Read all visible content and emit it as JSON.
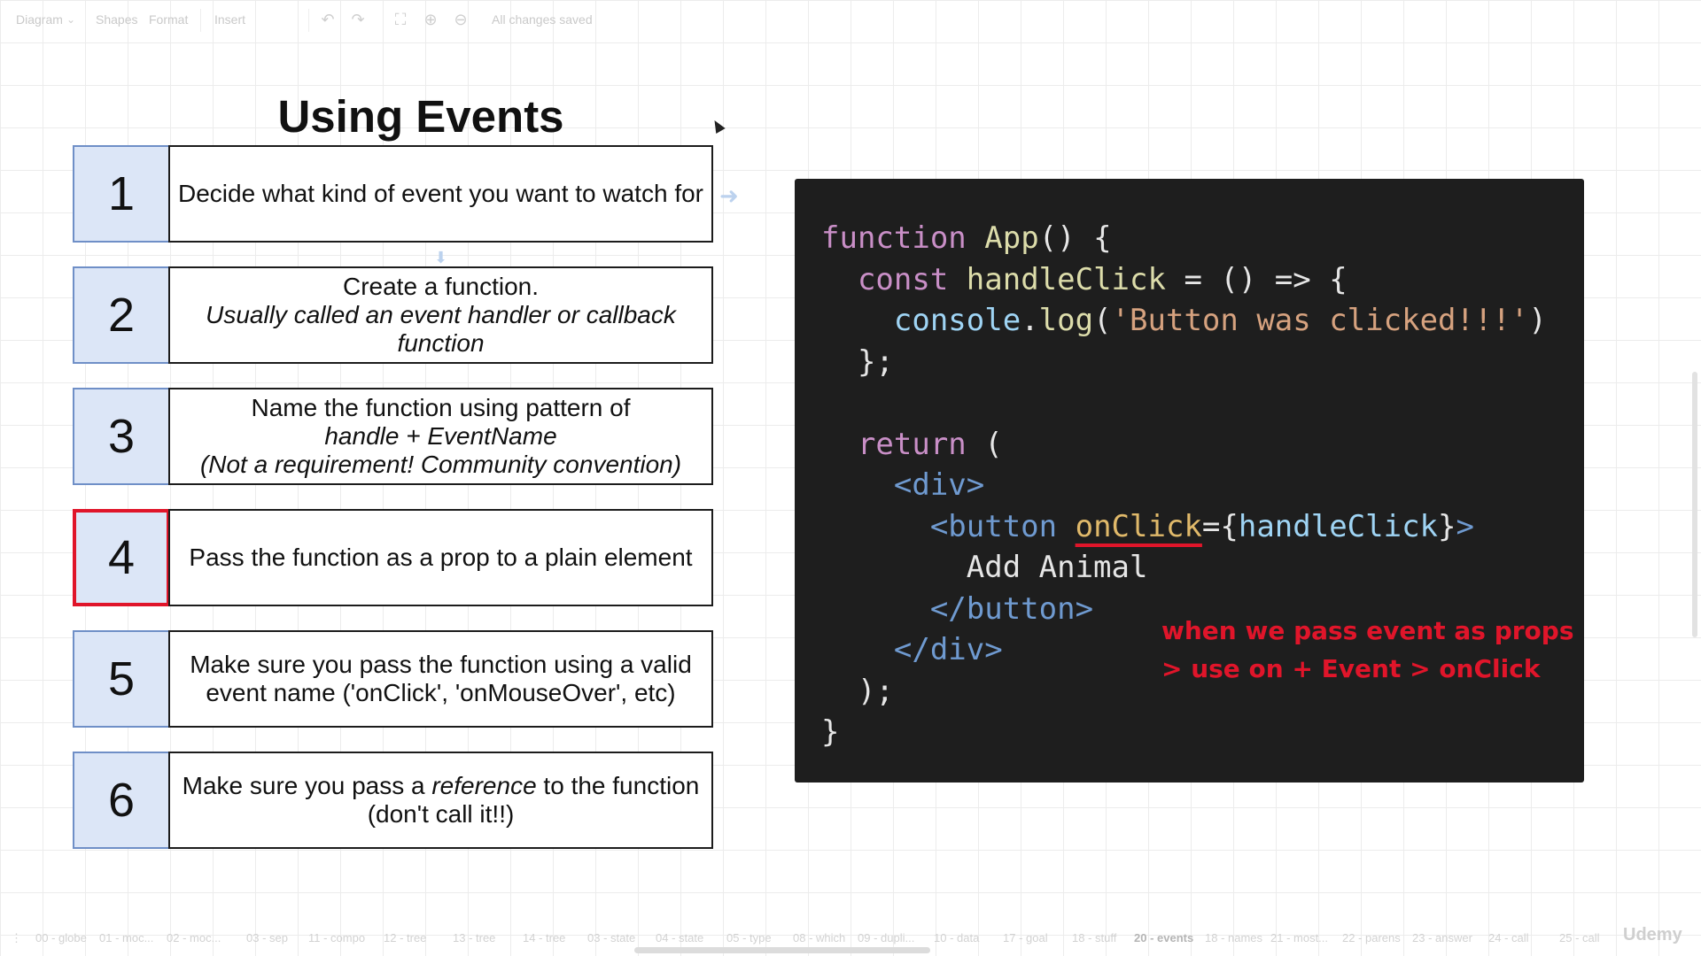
{
  "toolbar": {
    "diagram": "Diagram",
    "shapes": "Shapes",
    "format": "Format",
    "insert": "Insert",
    "status": "All changes saved"
  },
  "slide": {
    "title": "Using Events",
    "steps": [
      {
        "num": "1",
        "lines": [
          "Decide what kind of event you want to watch for"
        ]
      },
      {
        "num": "2",
        "lines": [
          "Create a function.",
          "Usually called an event handler or callback function"
        ]
      },
      {
        "num": "3",
        "lines": [
          "Name the function using pattern of",
          "handle + EventName",
          "(Not a requirement! Community convention)"
        ]
      },
      {
        "num": "4",
        "lines": [
          "Pass the function as a prop to a plain element"
        ]
      },
      {
        "num": "5",
        "lines": [
          "Make sure you pass the function using a valid event name ('onClick', 'onMouseOver', etc)"
        ]
      },
      {
        "num": "6",
        "pre": "Make sure you pass a ",
        "em": "reference",
        "post": " to the function (don't call it!!)"
      }
    ]
  },
  "code": {
    "l1_kw": "function",
    "l1_fn": "App",
    "l1_rest": "() {",
    "l2_kw": "const",
    "l2_fn": "handleClick",
    "l2_rest": " = () => {",
    "l3_obj": "console",
    "l3_dot": ".",
    "l3_fn": "log",
    "l3_open": "(",
    "l3_str": "'Button was clicked!!!'",
    "l3_close": ")",
    "l4": "};",
    "l6_kw": "return",
    "l6_rest": " (",
    "l7_tag": "<div>",
    "l8_tag": "<button",
    "l8_attr": "onClick",
    "l8_eq": "={",
    "l8_var": "handleClick",
    "l8_close": "}",
    "l8_end": ">",
    "l9": "Add Animal",
    "l10_tag": "</button>",
    "l11_tag": "</div>",
    "l12": ");",
    "l13": "}"
  },
  "annotation": {
    "line1": "when we pass event as props",
    "line2": "> use on + Event > onClick"
  },
  "tabs": [
    "00 - globe",
    "01 - moc...",
    "02 - moc...",
    "03 - sep",
    "11 - compo",
    "12 - tree",
    "13 - tree",
    "14 - tree",
    "03 - state",
    "04 - state",
    "05 - type",
    "08 - which",
    "09 - dupli...",
    "10 - data",
    "17 - goal",
    "18 - stuff",
    "20 - events",
    "18 - names",
    "21 - most...",
    "22 - parens",
    "23 - answer",
    "24 - call",
    "25 - call"
  ],
  "active_tab": "20 - events",
  "brand": "Udemy",
  "colors": {
    "accent_red": "#e0152a",
    "number_box": "#dce6f7",
    "code_bg": "#1e1e1e"
  }
}
